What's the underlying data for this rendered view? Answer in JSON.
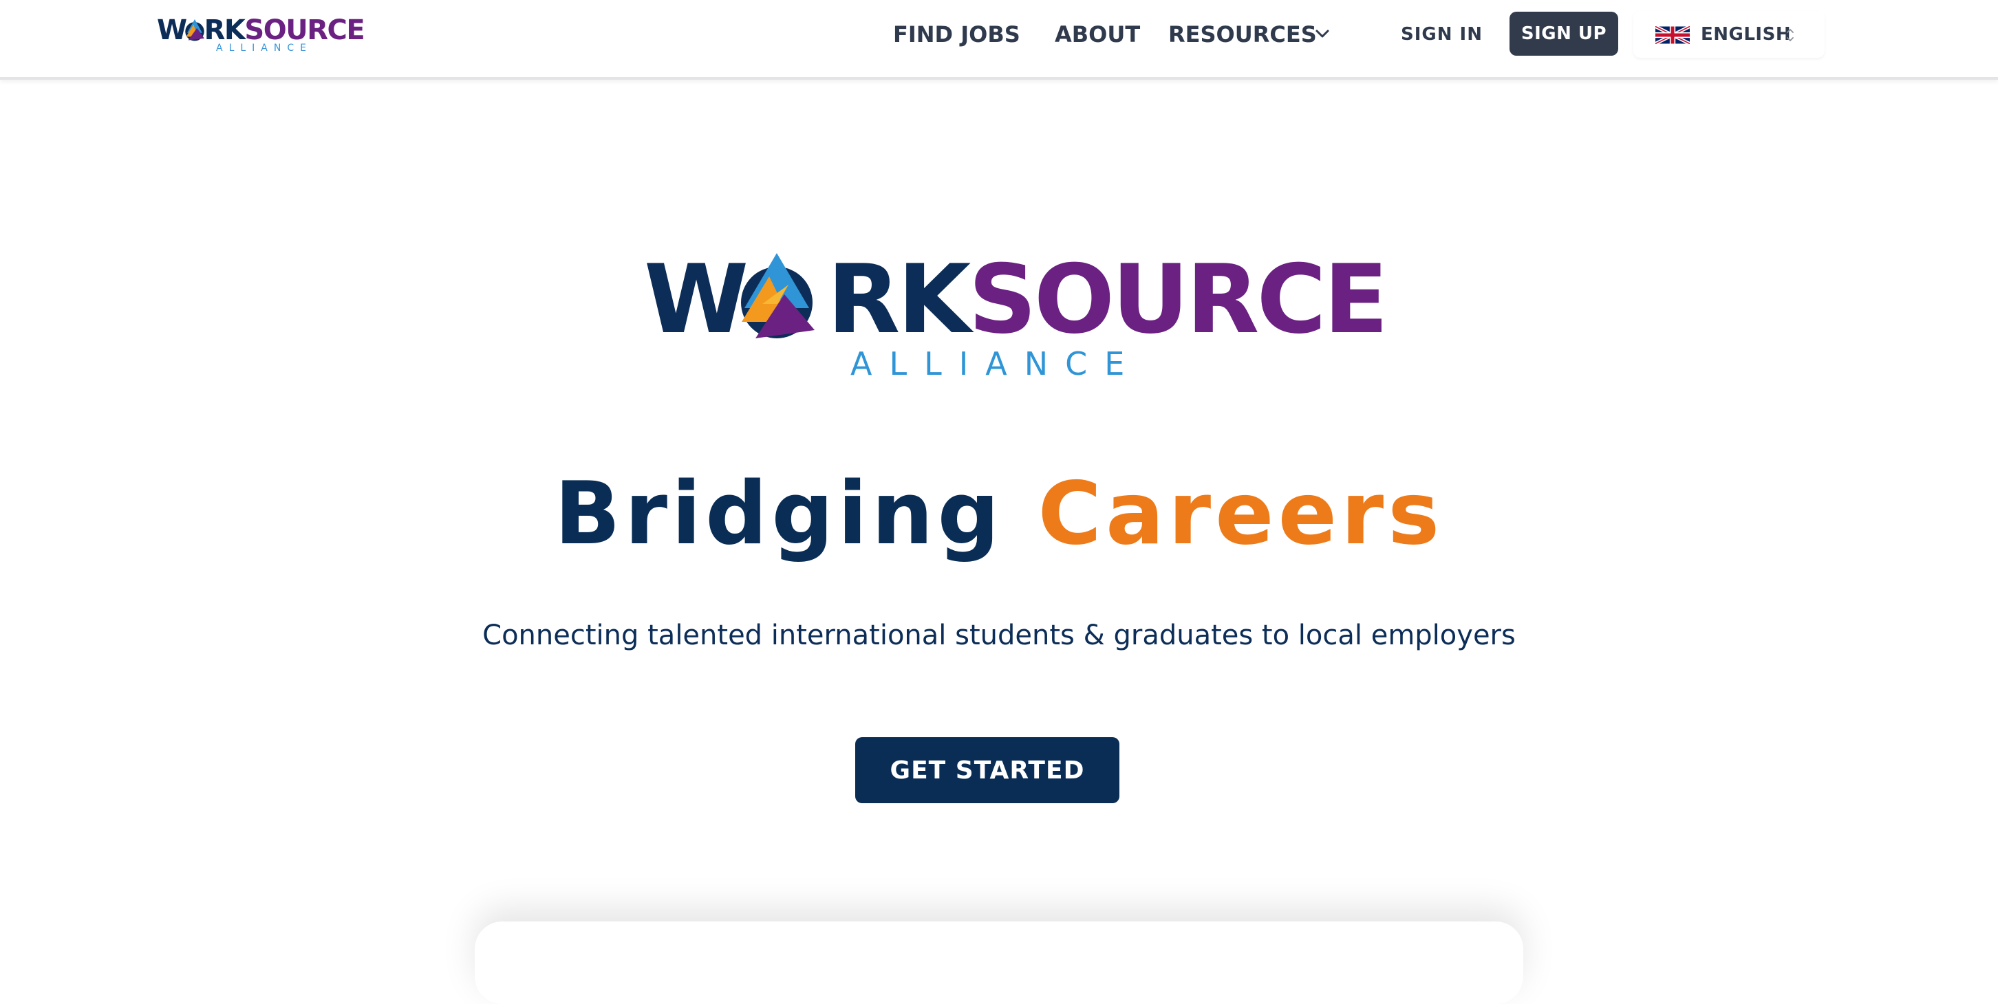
{
  "brand": {
    "name_part1": "W",
    "name_part2": "RK",
    "name_part3": "SOURCE",
    "subtitle": "ALLIANCE",
    "colors": {
      "navy": "#0c2d57",
      "purple": "#6b2182",
      "blue": "#2f95d6",
      "orange": "#ee7b1a"
    }
  },
  "nav": {
    "items": [
      {
        "label": "FIND JOBS"
      },
      {
        "label": "ABOUT"
      },
      {
        "label": "RESOURCES",
        "icon": "chevron-down-icon"
      }
    ],
    "sign_in": "SIGN IN",
    "sign_up": "SIGN UP",
    "language": {
      "label": "ENGLISH",
      "flag_icon": "uk-flag-icon",
      "toggle_icon": "updown-chevron-icon"
    }
  },
  "hero": {
    "headline_part1": "Bridging",
    "headline_part2": "Careers",
    "tagline": "Connecting talented international students & graduates to local employers",
    "cta": "GET STARTED"
  }
}
